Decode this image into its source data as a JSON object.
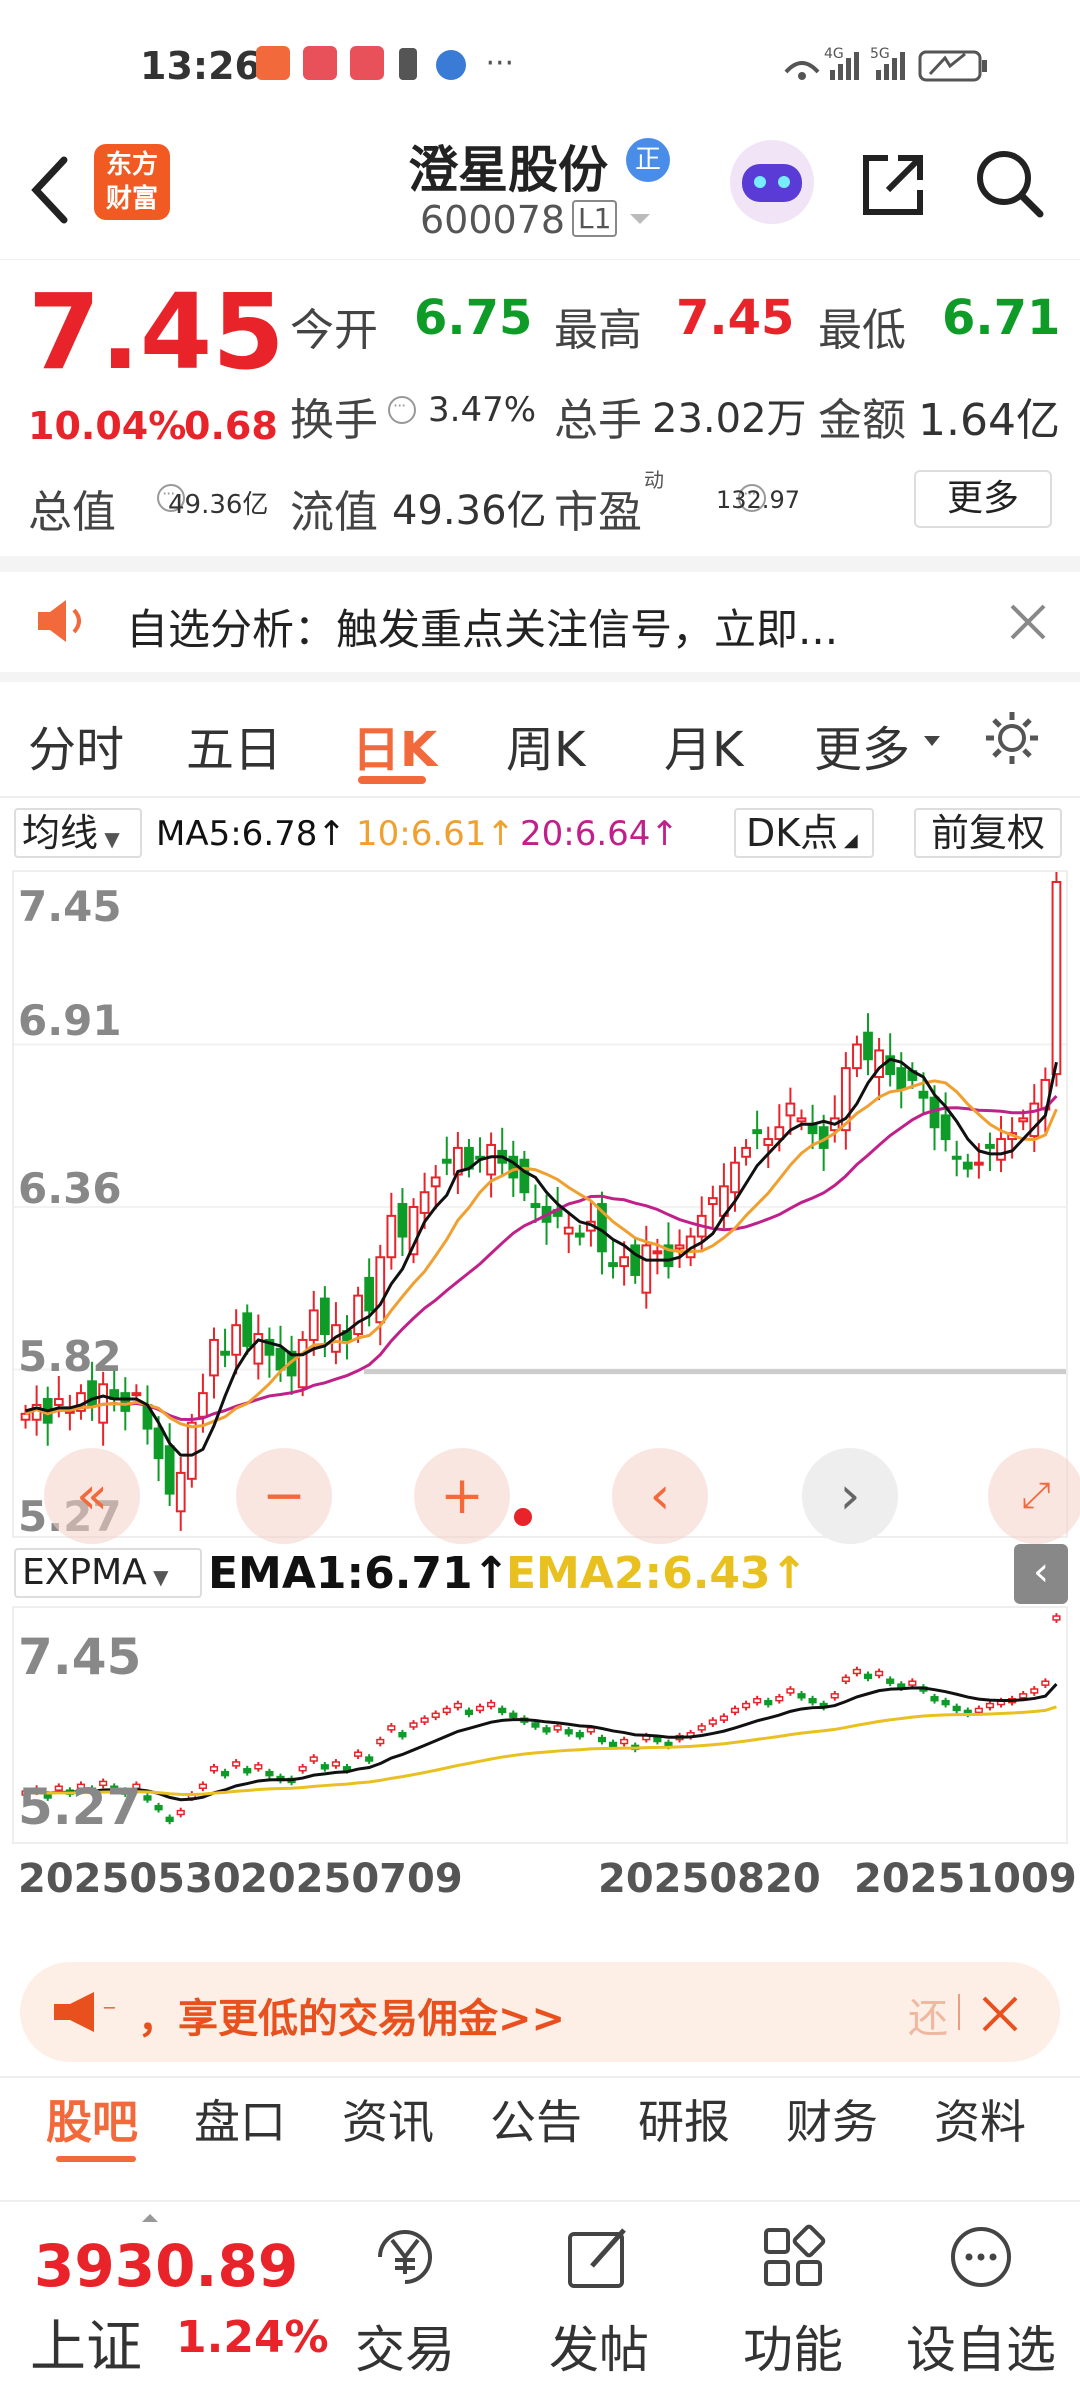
{
  "status": {
    "time": "13:26",
    "right": "4G 5G"
  },
  "header": {
    "title": "澄星股份",
    "badge": "正",
    "code": "600078",
    "level": "L1",
    "logo_line1": "东方",
    "logo_line2": "财富"
  },
  "quote": {
    "price": "7.45",
    "pct": "10.04%",
    "change": "0.68",
    "open_label": "今开",
    "open": "6.75",
    "high_label": "最高",
    "high": "7.45",
    "low_label": "最低",
    "low": "6.71",
    "turnover_label": "换手",
    "turnover": "3.47%",
    "vol_label": "总手",
    "vol": "23.02万",
    "amt_label": "金额",
    "amt": "1.64亿",
    "mcap_label": "总值",
    "mcap": "49.36亿",
    "float_label": "流值",
    "float": "49.36亿",
    "pe_label": "市盈",
    "pe_sup": "动",
    "pe": "132.97",
    "more": "更多"
  },
  "notice": {
    "text": "自选分析：触发重点关注信号，立即..."
  },
  "tabs": [
    "分时",
    "五日",
    "日K",
    "周K",
    "月K",
    "更多"
  ],
  "ma_bar": {
    "select": "均线",
    "ma5": "MA5:6.78↑",
    "ma10": "10:6.61↑",
    "ma20": "20:6.64↑",
    "dk": "DK点",
    "fq": "前复权"
  },
  "main_axis": [
    "7.45",
    "6.91",
    "6.36",
    "5.82",
    "5.27"
  ],
  "ema_bar": {
    "select": "EXPMA",
    "ema1": "EMA1:6.71↑",
    "ema2": "EMA2:6.43↑"
  },
  "ema_axis": [
    "7.45",
    "5.27"
  ],
  "dates": [
    "20250530",
    "20250709",
    "20250820",
    "20251009"
  ],
  "ad": {
    "text": "，享更低的交易佣金>>",
    "tail": "还"
  },
  "bottom_tabs": [
    "股吧",
    "盘口",
    "资讯",
    "公告",
    "研报",
    "财务",
    "资料"
  ],
  "nav": {
    "index_value": "3930.89",
    "index_name": "上证",
    "index_pct": "1.24%",
    "trade": "交易",
    "post": "发帖",
    "func": "功能",
    "watch": "设自选"
  },
  "colors": {
    "up": "#e8232a",
    "down": "#0e9b28",
    "accent": "#f26a3c",
    "ma5": "#111111",
    "ma10": "#f0a030",
    "ma20": "#c0208a",
    "ema2": "#e8c020"
  },
  "chart_data": {
    "type": "candlestick",
    "ylim": [
      5.27,
      7.45
    ],
    "x_ticks": [
      "20250530",
      "20250709",
      "20250820",
      "20251009"
    ],
    "close": [
      5.65,
      5.68,
      5.62,
      5.7,
      5.66,
      5.72,
      5.68,
      5.75,
      5.7,
      5.66,
      5.72,
      5.6,
      5.5,
      5.38,
      5.45,
      5.62,
      5.72,
      5.9,
      5.85,
      5.95,
      5.88,
      5.92,
      5.85,
      5.8,
      5.78,
      5.9,
      6.0,
      5.92,
      5.95,
      5.9,
      6.05,
      6.0,
      6.18,
      6.32,
      6.25,
      6.35,
      6.4,
      6.45,
      6.5,
      6.55,
      6.48,
      6.52,
      6.56,
      6.5,
      6.45,
      6.4,
      6.35,
      6.3,
      6.32,
      6.28,
      6.25,
      6.3,
      6.2,
      6.15,
      6.18,
      6.12,
      6.22,
      6.2,
      6.15,
      6.22,
      6.25,
      6.32,
      6.38,
      6.42,
      6.5,
      6.55,
      6.6,
      6.58,
      6.62,
      6.7,
      6.65,
      6.6,
      6.55,
      6.65,
      6.82,
      6.9,
      6.85,
      6.88,
      6.8,
      6.75,
      6.78,
      6.72,
      6.62,
      6.58,
      6.52,
      6.48,
      6.5,
      6.55,
      6.58,
      6.6,
      6.65,
      6.7,
      6.78,
      7.45
    ],
    "ma5": [
      5.66,
      5.67,
      5.66,
      5.67,
      5.67,
      5.68,
      5.7,
      5.71,
      5.7,
      5.7,
      5.7,
      5.68,
      5.62,
      5.55,
      5.51,
      5.51,
      5.53,
      5.61,
      5.71,
      5.8,
      5.86,
      5.9,
      5.89,
      5.88,
      5.85,
      5.85,
      5.87,
      5.88,
      5.91,
      5.93,
      5.96,
      5.98,
      6.02,
      6.09,
      6.14,
      6.22,
      6.3,
      6.35,
      6.39,
      6.47,
      6.48,
      6.51,
      6.52,
      6.52,
      6.5,
      6.47,
      6.45,
      6.4,
      6.36,
      6.33,
      6.3,
      6.29,
      6.27,
      6.24,
      6.22,
      6.19,
      6.17,
      6.17,
      6.17,
      6.18,
      6.21,
      6.23,
      6.26,
      6.32,
      6.37,
      6.43,
      6.49,
      6.53,
      6.57,
      6.61,
      6.63,
      6.63,
      6.64,
      6.63,
      6.65,
      6.7,
      6.77,
      6.82,
      6.85,
      6.84,
      6.81,
      6.79,
      6.73,
      6.69,
      6.64,
      6.58,
      6.54,
      6.53,
      6.53,
      6.54,
      6.58,
      6.62,
      6.66,
      6.84
    ]
  }
}
